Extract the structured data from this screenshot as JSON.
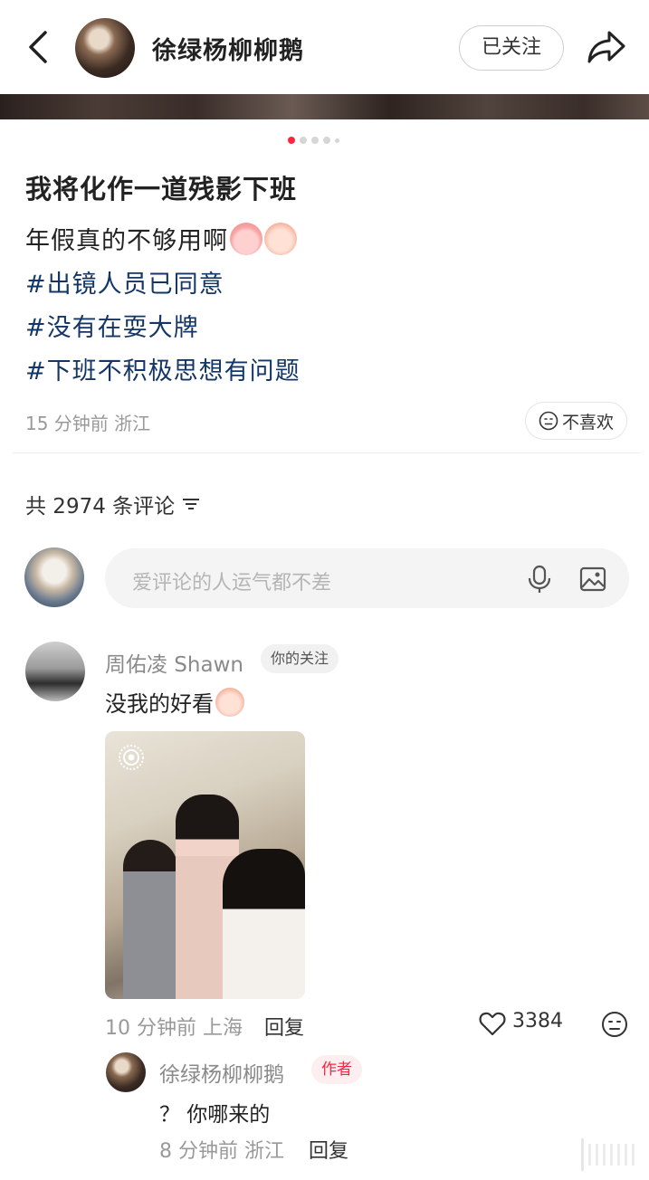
{
  "header": {
    "author_name": "徐绿杨柳柳鹅",
    "follow_label": "已关注"
  },
  "post": {
    "title": "我将化作一道残影下班",
    "body": "年假真的不够用啊",
    "tags": [
      "#出镜人员已同意",
      "#没有在耍大牌",
      "#下班不积极思想有问题"
    ],
    "meta": "15 分钟前  浙江",
    "dislike_label": "不喜欢",
    "pager": {
      "total": 5,
      "current": 1
    }
  },
  "comments_section": {
    "count_label": "共 2974 条评论",
    "input_placeholder": "爱评论的人运气都不差"
  },
  "comment": {
    "user": "周佑凌 Shawn",
    "badge": "你的关注",
    "text": "没我的好看",
    "meta": "10 分钟前  上海",
    "reply_label": "回复",
    "likes": "3384"
  },
  "reply": {
    "user": "徐绿杨柳柳鹅",
    "badge": "作者",
    "text": "？ 你哪来的",
    "meta": "8 分钟前  浙江",
    "reply_label": "回复"
  },
  "colors": {
    "accent": "#ff2442",
    "tag": "#133667"
  }
}
